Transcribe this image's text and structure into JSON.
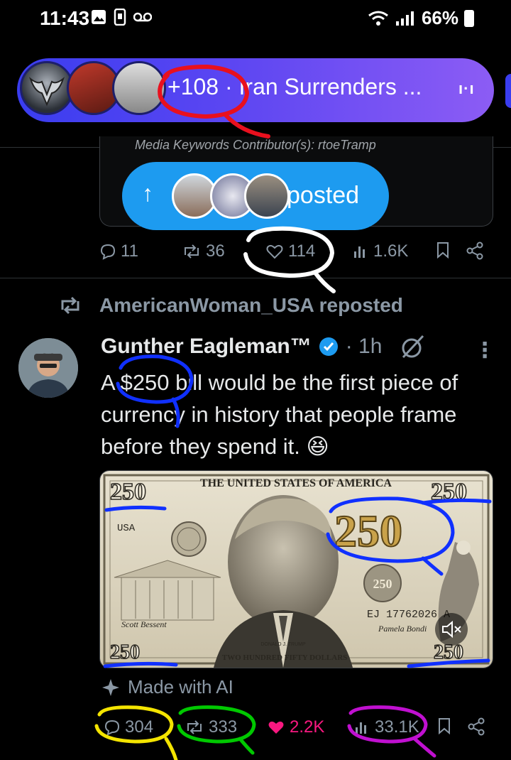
{
  "status_bar": {
    "time": "11:43",
    "battery": "66%"
  },
  "live_pill": {
    "text": "+108 · Iran Surrenders ...",
    "spark": "ı·ı"
  },
  "quote_card": {
    "cut_text": "Media Keywords Contributor(s): rtoeTramp"
  },
  "toast": {
    "label": "posted"
  },
  "action_bar_1": {
    "replies": "11",
    "reposts": "36",
    "likes": "114",
    "views": "1.6K"
  },
  "repost_header": {
    "text": "AmericanWoman_USA reposted"
  },
  "tweet": {
    "author": "Gunther Eagleman™",
    "time": "· 1h",
    "text": "A $250 bill would be the first piece of currency in history that people frame before they spend it. 😆",
    "ai_label": "Made with AI"
  },
  "bill": {
    "denom": "250",
    "header": "THE UNITED STATES OF AMERICA",
    "serial": "EJ 17762026 A",
    "country": "USA",
    "footer": "TWO HUNDRED FIFTY DOLLARS",
    "signer_left": "Scott Bessent",
    "signer_right": "Pamela Bondi",
    "portrait_caption": "DONALD J. TRUMP"
  },
  "action_bar_2": {
    "replies": "304",
    "reposts": "333",
    "likes": "2.2K",
    "views": "33.1K"
  },
  "colors": {
    "accent": "#1d9bf0",
    "like_pink": "#f91880",
    "pill_start": "#3a3df0",
    "pill_end": "#8c5cf4"
  }
}
